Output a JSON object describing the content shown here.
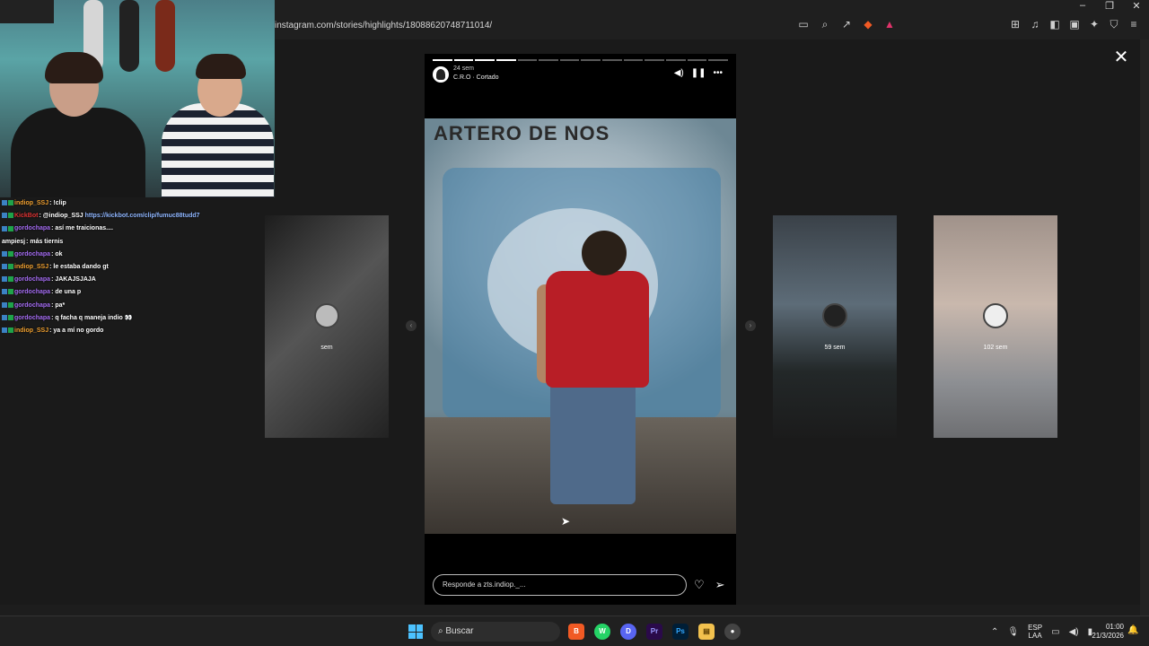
{
  "browser": {
    "url": "instagram.com/stories/highlights/18088620748711014/"
  },
  "story": {
    "time": "24 sem",
    "music": "C.R.O · Cortado",
    "photo_text": "ARTERO DE NOS",
    "reply_placeholder": "Responde a zts.indiop._...",
    "progress_total": 14,
    "progress_done": 4
  },
  "previews": [
    {
      "time": "sem"
    },
    {
      "time": "59 sem"
    },
    {
      "time": "102 sem"
    }
  ],
  "chat": [
    {
      "user": "indiop_SSJ",
      "color": "#f0a030",
      "msg": ": !clip",
      "link": ""
    },
    {
      "user": "KickBot",
      "color": "#d33",
      "msg": ": @indiop_SSJ",
      "link": " https://kickbot.com/clip/fumuc88tudd7"
    },
    {
      "user": "gordochapa",
      "color": "#a46cf2",
      "msg": ": así me traicionas....",
      "link": ""
    },
    {
      "user": "ampiesj",
      "color": "#ffffff",
      "msg": ": más tiernis",
      "link": ""
    },
    {
      "user": "gordochapa",
      "color": "#a46cf2",
      "msg": ": ok",
      "link": ""
    },
    {
      "user": "indiop_SSJ",
      "color": "#f0a030",
      "msg": ": le estaba dando gt",
      "link": ""
    },
    {
      "user": "gordochapa",
      "color": "#a46cf2",
      "msg": ": JAKAJSJAJA",
      "link": ""
    },
    {
      "user": "gordochapa",
      "color": "#a46cf2",
      "msg": ": de una p",
      "link": ""
    },
    {
      "user": "gordochapa",
      "color": "#a46cf2",
      "msg": ": pa*",
      "link": ""
    },
    {
      "user": "gordochapa",
      "color": "#a46cf2",
      "msg": ": q facha q maneja indio 👀",
      "link": ""
    },
    {
      "user": "indiop_SSJ",
      "color": "#f0a030",
      "msg": ": ya a mí no gordo",
      "link": ""
    }
  ],
  "taskbar": {
    "search": "Buscar",
    "lang_line1": "ESP",
    "lang_line2": "LAA",
    "time": "01:00",
    "date": "21/3/2026",
    "apps": [
      {
        "name": "brave",
        "glyph": "B"
      },
      {
        "name": "whatsapp",
        "glyph": "W"
      },
      {
        "name": "discord",
        "glyph": "D"
      },
      {
        "name": "premiere",
        "glyph": "Pr"
      },
      {
        "name": "photoshop",
        "glyph": "Ps"
      },
      {
        "name": "explorer",
        "glyph": "▤"
      },
      {
        "name": "obs",
        "glyph": "●"
      }
    ]
  }
}
